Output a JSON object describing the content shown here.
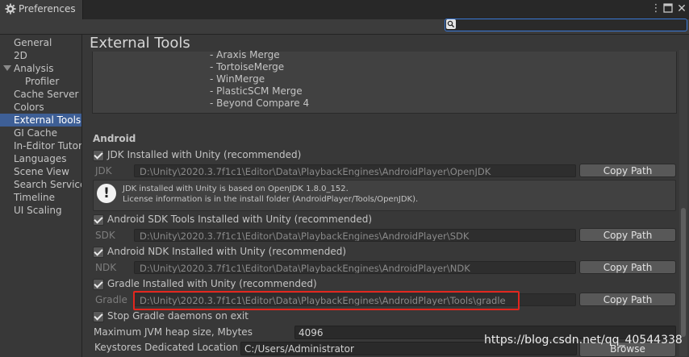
{
  "window": {
    "title": "Preferences",
    "icons": {
      "settings": "gear-icon",
      "more": "more-vert-icon",
      "maximize": "maximize-icon",
      "close": "close-icon"
    },
    "more_glyph": "⋮",
    "close_glyph": "✕"
  },
  "search": {
    "placeholder": "",
    "value": "",
    "icon": "search-icon"
  },
  "sidebar": {
    "items": [
      {
        "label": "General"
      },
      {
        "label": "2D"
      },
      {
        "label": "Analysis"
      },
      {
        "label": "Profiler"
      },
      {
        "label": "Cache Server ("
      },
      {
        "label": "Colors"
      },
      {
        "label": "External Tools",
        "selected": true
      },
      {
        "label": "GI Cache"
      },
      {
        "label": "In-Editor Tutor"
      },
      {
        "label": "Languages"
      },
      {
        "label": "Scene View"
      },
      {
        "label": "Search Service"
      },
      {
        "label": "Timeline"
      },
      {
        "label": "UI Scaling"
      }
    ]
  },
  "main": {
    "title": "External Tools",
    "merge_tools": [
      "- Araxis Merge",
      "- TortoiseMerge",
      "- WinMerge",
      "- PlasticSCM Merge",
      "- Beyond Compare 4"
    ],
    "android": {
      "heading": "Android",
      "jdk": {
        "checkbox": "JDK Installed with Unity (recommended)",
        "checked": true,
        "label": "JDK",
        "path": "D:\\Unity\\2020.3.7f1c1\\Editor\\Data\\PlaybackEngines\\AndroidPlayer\\OpenJDK",
        "button": "Copy Path"
      },
      "info": {
        "icon": "info-icon",
        "glyph": "!",
        "line1": "JDK installed with Unity is based on OpenJDK 1.8.0_152.",
        "line2": "License information is in the install folder (AndroidPlayer/Tools/OpenJDK)."
      },
      "sdk": {
        "checkbox": "Android SDK Tools Installed with Unity (recommended)",
        "checked": true,
        "label": "SDK",
        "path": "D:\\Unity\\2020.3.7f1c1\\Editor\\Data\\PlaybackEngines\\AndroidPlayer\\SDK",
        "button": "Copy Path"
      },
      "ndk": {
        "checkbox": "Android NDK Installed with Unity (recommended)",
        "checked": true,
        "label": "NDK",
        "path": "D:\\Unity\\2020.3.7f1c1\\Editor\\Data\\PlaybackEngines\\AndroidPlayer\\NDK",
        "button": "Copy Path"
      },
      "gradle": {
        "checkbox": "Gradle Installed with Unity (recommended)",
        "checked": true,
        "label": "Gradle",
        "path": "D:\\Unity\\2020.3.7f1c1\\Editor\\Data\\PlaybackEngines\\AndroidPlayer\\Tools\\gradle",
        "button": "Copy Path"
      },
      "stop_gradle": {
        "checkbox": "Stop Gradle daemons on exit",
        "checked": true
      },
      "jvm_heap": {
        "label": "Maximum JVM heap size, Mbytes",
        "value": "4096"
      },
      "keystores": {
        "label": "Keystores Dedicated Location",
        "value": "C:/Users/Administrator",
        "button": "Browse"
      }
    }
  },
  "watermark": "https://blog.csdn.net/qq_40544338",
  "colors": {
    "selection": "#3e5f96",
    "highlight_box": "#e2261e",
    "search_focus": "#3a79d7"
  }
}
